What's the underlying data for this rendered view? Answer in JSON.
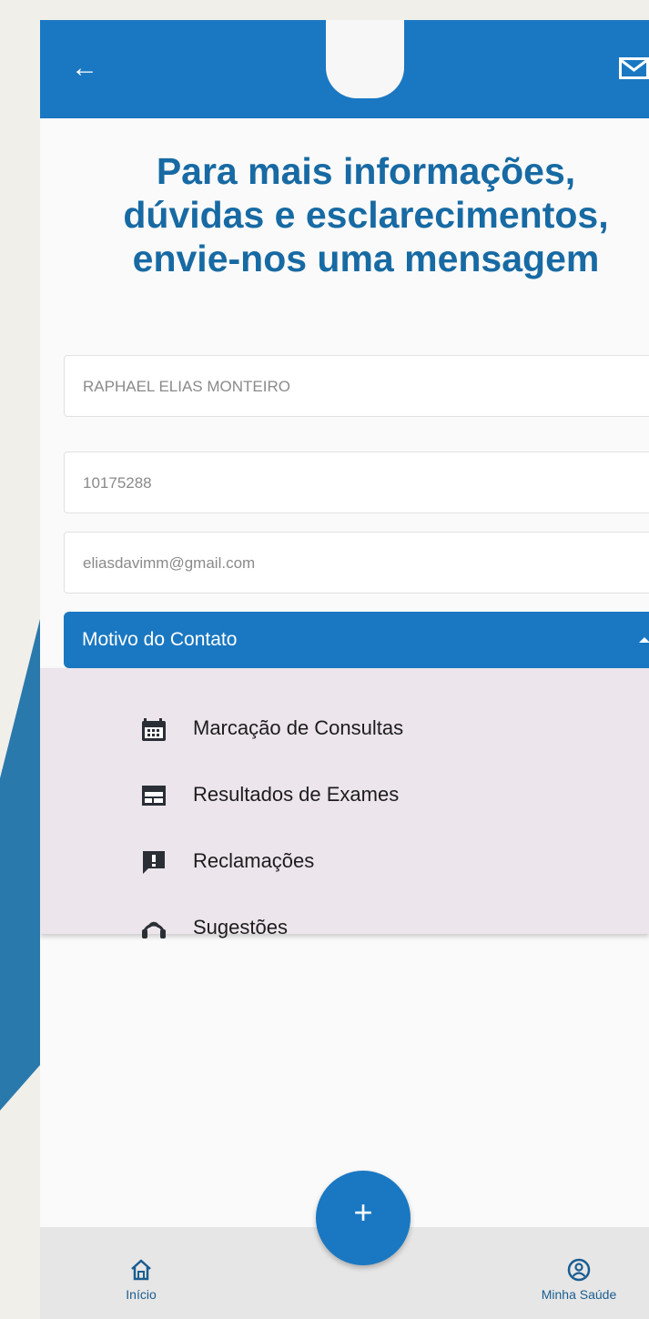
{
  "header": {
    "back_icon": "arrow-left-icon",
    "mail_icon": "mail-icon"
  },
  "headline": {
    "line1": "Para mais informações,",
    "line2": "dúvidas e esclarecimentos,",
    "line3": "envie-nos uma mensagem"
  },
  "form": {
    "name_value": "RAPHAEL ELIAS MONTEIRO",
    "id_value": "10175288",
    "email_value": "eliasdavimm@gmail.com"
  },
  "dropdown": {
    "label": "Motivo do Contato",
    "expanded": true,
    "options": [
      {
        "label": "Marcação de Consultas",
        "icon": "calendar-icon"
      },
      {
        "label": "Resultados de Exames",
        "icon": "table-icon"
      },
      {
        "label": "Reclamações",
        "icon": "alert-message-icon"
      },
      {
        "label": "Sugestões",
        "icon": "support-icon"
      }
    ]
  },
  "bottom_nav": {
    "home_label": "Início",
    "home_icon": "home-icon",
    "fab_icon": "plus-icon",
    "fab_glyph": "+",
    "health_label": "Minha Saúde",
    "health_icon": "user-circle-icon"
  },
  "colors": {
    "primary": "#1a78c2",
    "headline": "#176aa3",
    "menu_background": "#ece5ec",
    "page_background": "#f1efe9"
  }
}
